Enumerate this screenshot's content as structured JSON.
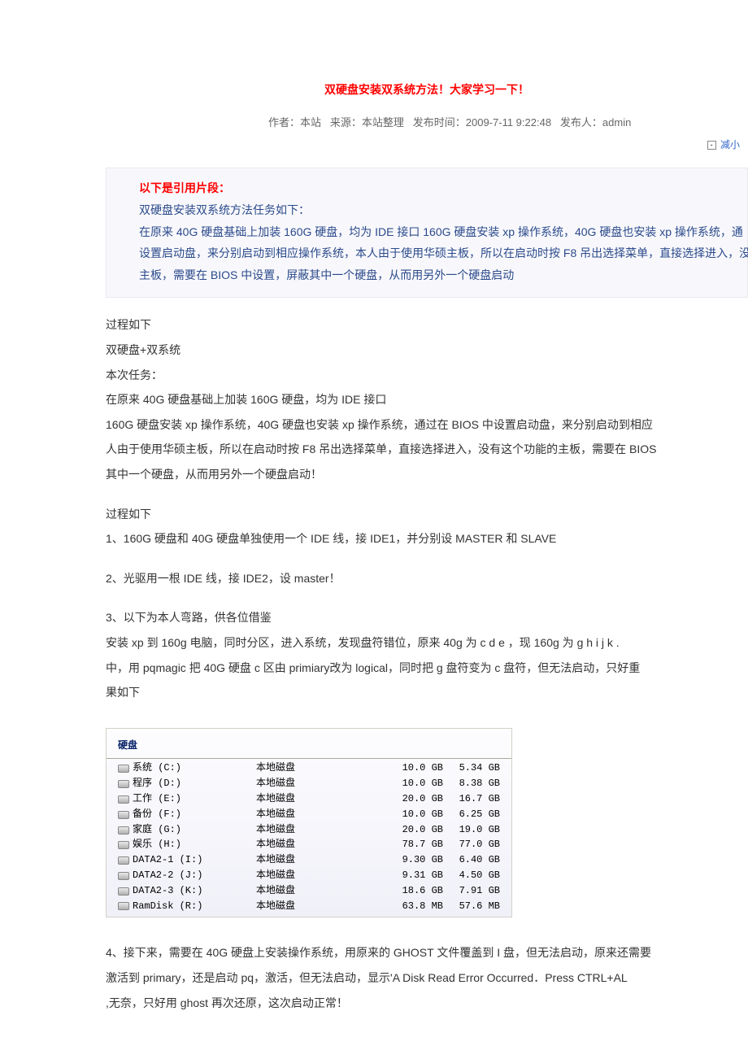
{
  "title": "双硬盘安装双系统方法！大家学习一下！",
  "meta": {
    "author_label": "作者：",
    "author": "本站",
    "source_label": "来源：",
    "source": "本站整理",
    "pubtime_label": "发布时间：",
    "pubtime": "2009-7-11 9:22:48",
    "publisher_label": "发布人：",
    "publisher": "admin"
  },
  "font_control": {
    "minus": "-",
    "reduce": "减小"
  },
  "quote": {
    "title": "以下是引用片段：",
    "lines": [
      "双硬盘安装双系统方法任务如下：",
      "在原来 40G 硬盘基础上加装 160G 硬盘，均为 IDE 接口 160G 硬盘安装 xp 操作系统，40G 硬盘也安装 xp 操作系统，通",
      "设置启动盘，来分别启动到相应操作系统，本人由于使用华硕主板，所以在启动时按 F8 吊出选择菜单，直接选择进入，没有",
      "主板，需要在 BIOS 中设置，屏蔽其中一个硬盘，从而用另外一个硬盘启动"
    ]
  },
  "body": {
    "p1": "过程如下",
    "p2": "双硬盘+双系统",
    "p3": "本次任务：",
    "p4": "在原来 40G 硬盘基础上加装 160G 硬盘，均为 IDE 接口",
    "p5": "160G 硬盘安装 xp 操作系统，40G 硬盘也安装 xp 操作系统，通过在 BIOS 中设置启动盘，来分别启动到相应",
    "p6": "人由于使用华硕主板，所以在启动时按 F8 吊出选择菜单，直接选择进入，没有这个功能的主板，需要在 BIOS",
    "p7": "其中一个硬盘，从而用另外一个硬盘启动！",
    "p8": "过程如下",
    "p9": "1、160G 硬盘和 40G 硬盘单独使用一个 IDE 线，接 IDE1，并分别设 MASTER 和 SLAVE",
    "p10": "2、光驱用一根 IDE 线，接 IDE2，设 master！",
    "p11": "3、以下为本人弯路，供各位借鉴",
    "p12": "安装 xp 到 160g 电脑，同时分区，进入系统，发现盘符错位，原来 40g 为 c  d  e ，现 160g 为 g  h  i  j  k  .",
    "p13": "中，用 pqmagic 把 40G 硬盘 c 区由 primiary改为 logical，同时把 g 盘符变为 c 盘符，但无法启动，只好重",
    "p14": "果如下",
    "p15": "4、接下来，需要在 40G 硬盘上安装操作系统，用原来的 GHOST 文件覆盖到 I 盘，但无法启动，原来还需要",
    "p16": "激活到 primary，还是启动 pq，激活，但无法启动，显示'A Disk Read Error Occurred．Press CTRL+AL",
    "p17": ",无奈，只好用 ghost 再次还原，这次启动正常！"
  },
  "disk": {
    "header": "硬盘",
    "type_label": "本地磁盘",
    "rows": [
      {
        "name": "系统 (C:)",
        "type": "本地磁盘",
        "size": "10.0 GB",
        "free": "5.34 GB"
      },
      {
        "name": "程序 (D:)",
        "type": "本地磁盘",
        "size": "10.0 GB",
        "free": "8.38 GB"
      },
      {
        "name": "工作 (E:)",
        "type": "本地磁盘",
        "size": "20.0 GB",
        "free": "16.7 GB"
      },
      {
        "name": "备份 (F:)",
        "type": "本地磁盘",
        "size": "10.0 GB",
        "free": "6.25 GB"
      },
      {
        "name": "家庭 (G:)",
        "type": "本地磁盘",
        "size": "20.0 GB",
        "free": "19.0 GB"
      },
      {
        "name": "娱乐 (H:)",
        "type": "本地磁盘",
        "size": "78.7 GB",
        "free": "77.0 GB"
      },
      {
        "name": "DATA2-1 (I:)",
        "type": "本地磁盘",
        "size": "9.30 GB",
        "free": "6.40 GB"
      },
      {
        "name": "DATA2-2 (J:)",
        "type": "本地磁盘",
        "size": "9.31 GB",
        "free": "4.50 GB"
      },
      {
        "name": "DATA2-3 (K:)",
        "type": "本地磁盘",
        "size": "18.6 GB",
        "free": "7.91 GB"
      },
      {
        "name": "RamDisk (R:)",
        "type": "本地磁盘",
        "size": "63.8 MB",
        "free": "57.6 MB"
      }
    ]
  }
}
